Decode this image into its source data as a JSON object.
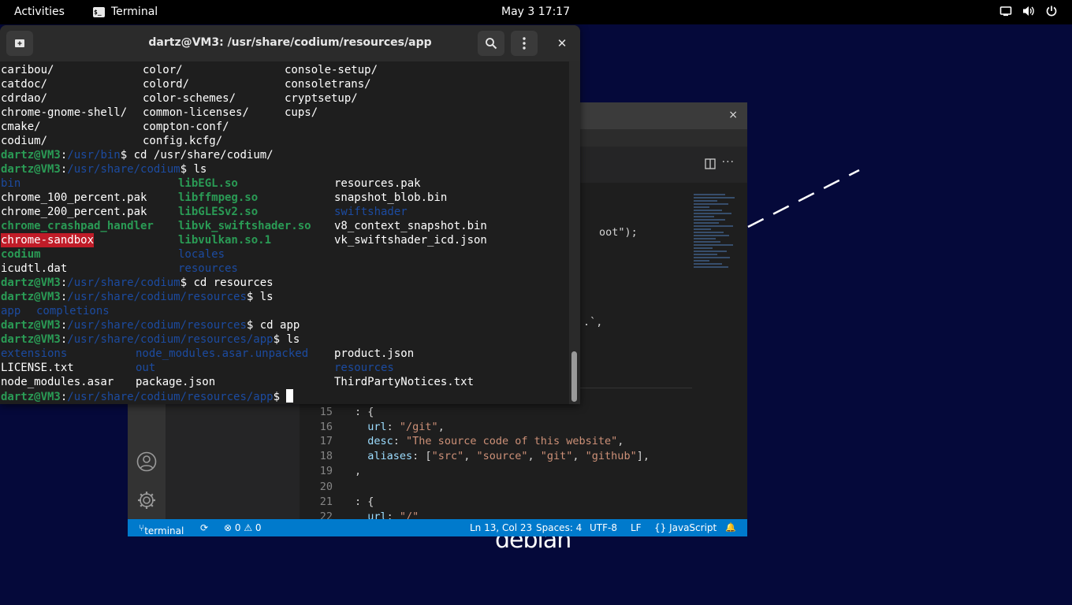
{
  "topbar": {
    "activities": "Activities",
    "app_name": "Terminal",
    "app_icon_text": "$_",
    "clock": "May 3  17:17"
  },
  "desktop": {
    "logo_text": "debian"
  },
  "editor": {
    "close_label": "×",
    "more_label": "···",
    "code": {
      "frag_root": "oot\");",
      "frag_tick": ".`,",
      "line15": {
        "num": "15",
        "text": ": {"
      },
      "line16": {
        "num": "16",
        "key": "url",
        "value": "\"/git\""
      },
      "line17": {
        "num": "17",
        "key": "desc",
        "value": "\"The source code of this website\""
      },
      "line18": {
        "num": "18",
        "key": "aliases",
        "v1": "\"src\"",
        "v2": "\"source\"",
        "v3": "\"git\"",
        "v4": "\"github\""
      },
      "line19": {
        "num": "19",
        "text": ","
      },
      "line20": {
        "num": "20",
        "text": ""
      },
      "line21": {
        "num": "21",
        "text": ": {"
      },
      "line22": {
        "num": "22",
        "key": "url",
        "value": "\"/\""
      }
    },
    "status": {
      "branch": "terminal",
      "sync": "⟳",
      "problems": "⊗ 0 ⚠ 0",
      "position": "Ln 13, Col 23",
      "spaces": "Spaces: 4",
      "encoding": "UTF-8",
      "eol": "LF",
      "language": "{} JavaScript",
      "bell": "🔔"
    }
  },
  "terminal": {
    "title": "dartz@VM3: /usr/share/codium/resources/app",
    "close_label": "✕",
    "user": "dartz@VM3",
    "lines": {
      "l1": [
        "caribou/",
        "color/",
        "console-setup/"
      ],
      "l2": [
        "catdoc/",
        "colord/",
        "consoletrans/"
      ],
      "l3": [
        "cdrdao/",
        "color-schemes/",
        "cryptsetup/"
      ],
      "l4": [
        "chrome-gnome-shell/",
        "common-licenses/",
        "cups/"
      ],
      "l5": [
        "cmake/",
        "compton-conf/"
      ],
      "l6": [
        "codium/",
        "config.kcfg/"
      ],
      "p1": {
        "path": "/usr/bin",
        "cmd": " cd /usr/share/codium/"
      },
      "p2": {
        "path": "/usr/share/codium",
        "cmd": " ls"
      },
      "ls1_1": [
        "bin",
        "libEGL.so",
        "resources.pak"
      ],
      "ls1_2": [
        "chrome_100_percent.pak",
        "libffmpeg.so",
        "snapshot_blob.bin"
      ],
      "ls1_3": [
        "chrome_200_percent.pak",
        "libGLESv2.so",
        "swiftshader"
      ],
      "ls1_4": [
        "chrome_crashpad_handler",
        "libvk_swiftshader.so",
        "v8_context_snapshot.bin"
      ],
      "ls1_5": [
        "chrome-sandbox",
        "libvulkan.so.1",
        "vk_swiftshader_icd.json"
      ],
      "ls1_6": [
        "codium",
        "locales"
      ],
      "ls1_7": [
        "icudtl.dat",
        "resources"
      ],
      "p3": {
        "path": "/usr/share/codium",
        "cmd": " cd resources"
      },
      "p4": {
        "path": "/usr/share/codium/resources",
        "cmd": " ls"
      },
      "ls2": [
        "app",
        "completions"
      ],
      "p5": {
        "path": "/usr/share/codium/resources",
        "cmd": " cd app"
      },
      "p6": {
        "path": "/usr/share/codium/resources/app",
        "cmd": " ls"
      },
      "ls3_1": [
        "extensions",
        "node_modules.asar.unpacked",
        "product.json"
      ],
      "ls3_2": [
        "LICENSE.txt",
        "out",
        "resources"
      ],
      "ls3_3": [
        "node_modules.asar",
        "package.json",
        "ThirdPartyNotices.txt"
      ],
      "p7": {
        "path": "/usr/share/codium/resources/app",
        "cmd": " "
      }
    }
  },
  "colors": {
    "desktop_bg": "#05093a",
    "prompt_user": "#2a9b55",
    "prompt_path": "#1c4ba0",
    "status_bar": "#007acc",
    "highlight": "#c01c28"
  }
}
